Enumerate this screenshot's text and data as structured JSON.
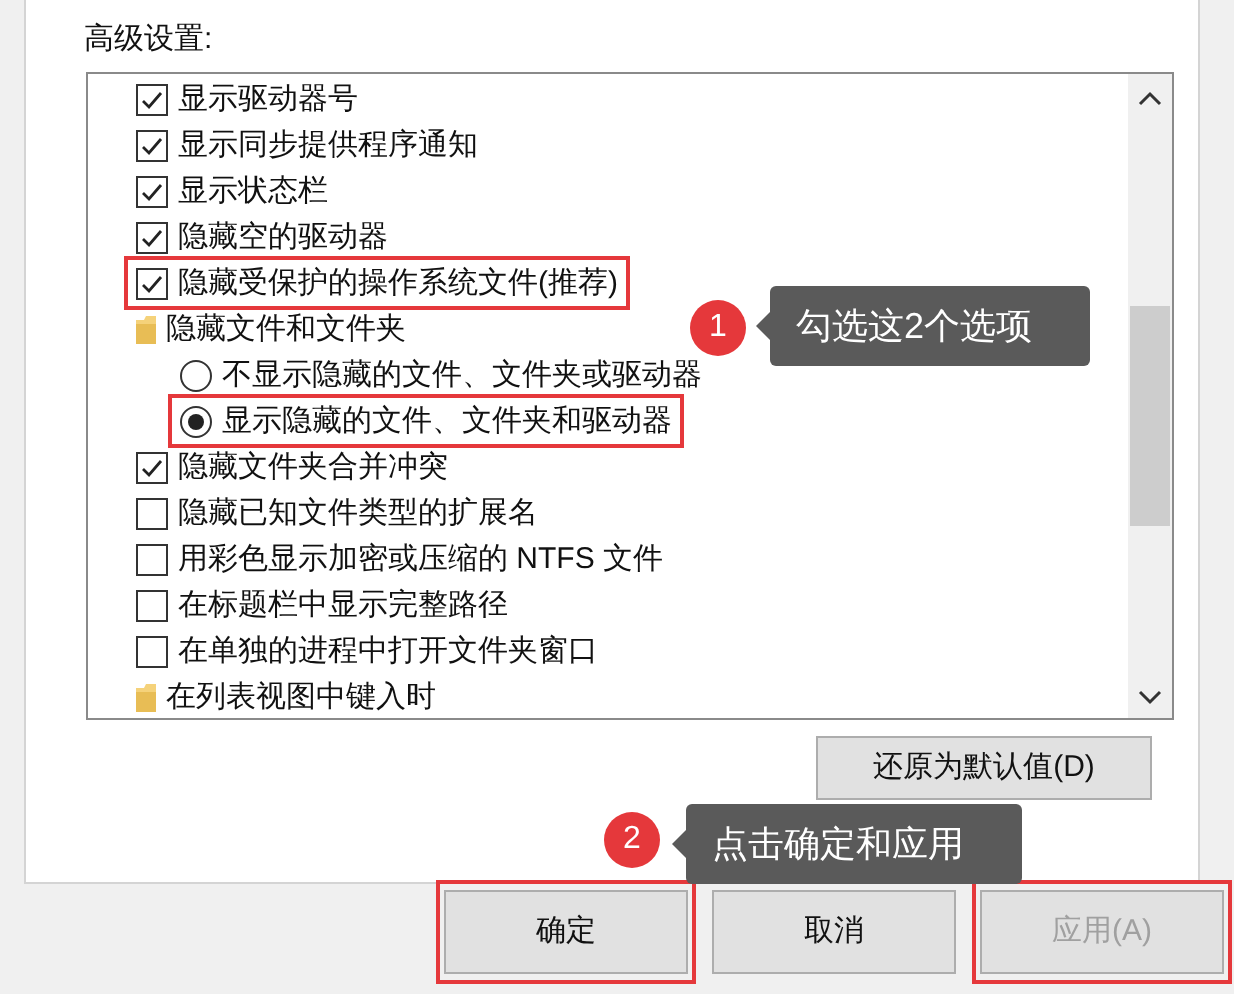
{
  "section_label": "高级设置:",
  "settings": [
    {
      "kind": "checkbox",
      "label": "显示驱动器号",
      "checked": true,
      "highlighted": false
    },
    {
      "kind": "checkbox",
      "label": "显示同步提供程序通知",
      "checked": true,
      "highlighted": false
    },
    {
      "kind": "checkbox",
      "label": "显示状态栏",
      "checked": true,
      "highlighted": false
    },
    {
      "kind": "checkbox",
      "label": "隐藏空的驱动器",
      "checked": true,
      "highlighted": false
    },
    {
      "kind": "checkbox",
      "label": "隐藏受保护的操作系统文件(推荐)",
      "checked": true,
      "highlighted": true
    },
    {
      "kind": "folder",
      "label": "隐藏文件和文件夹",
      "children": [
        {
          "kind": "radio",
          "label": "不显示隐藏的文件、文件夹或驱动器",
          "selected": false,
          "highlighted": false
        },
        {
          "kind": "radio",
          "label": "显示隐藏的文件、文件夹和驱动器",
          "selected": true,
          "highlighted": true
        }
      ]
    },
    {
      "kind": "checkbox",
      "label": "隐藏文件夹合并冲突",
      "checked": true,
      "highlighted": false
    },
    {
      "kind": "checkbox",
      "label": "隐藏已知文件类型的扩展名",
      "checked": false,
      "highlighted": false
    },
    {
      "kind": "checkbox",
      "label": "用彩色显示加密或压缩的 NTFS 文件",
      "checked": false,
      "highlighted": false
    },
    {
      "kind": "checkbox",
      "label": "在标题栏中显示完整路径",
      "checked": false,
      "highlighted": false
    },
    {
      "kind": "checkbox",
      "label": "在单独的进程中打开文件夹窗口",
      "checked": false,
      "highlighted": false
    },
    {
      "kind": "folder",
      "label": "在列表视图中键入时"
    }
  ],
  "reset_button": "还原为默认值(D)",
  "annotations": [
    {
      "number": "1",
      "text": "勾选这2个选项"
    },
    {
      "number": "2",
      "text": "点击确定和应用"
    }
  ],
  "buttons": [
    {
      "label": "确定",
      "disabled": false,
      "highlighted": true
    },
    {
      "label": "取消",
      "disabled": false,
      "highlighted": false
    },
    {
      "label": "应用(A)",
      "disabled": true,
      "highlighted": true
    }
  ]
}
